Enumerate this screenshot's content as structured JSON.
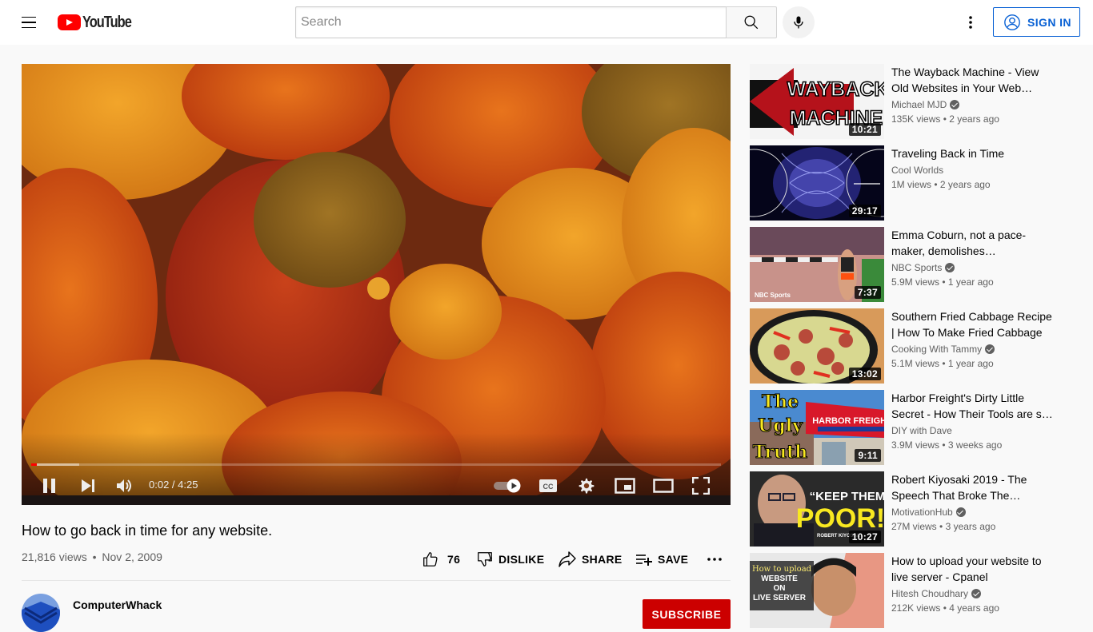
{
  "header": {
    "logo_text": "YouTube",
    "search_placeholder": "Search",
    "sign_in_label": "SIGN IN"
  },
  "colors": {
    "brand_red": "#ff0000",
    "subscribe_red": "#cc0000",
    "link_blue": "#065fd4",
    "muted_text": "#606060"
  },
  "player": {
    "time_display": "0:02 / 4:25",
    "current_time": "0:02",
    "duration": "4:25",
    "played_fraction": 0.008,
    "buffered_fraction": 0.07,
    "autoplay": true
  },
  "video": {
    "title": "How to go back in time for any website.",
    "views": "21,816 views",
    "date": "Nov 2, 2009",
    "meta_separator": "•",
    "likes": "76",
    "dislike_label": "DISLIKE",
    "share_label": "SHARE",
    "save_label": "SAVE",
    "channel_name": "ComputerWhack",
    "subscribe_label": "SUBSCRIBE"
  },
  "recommendations": [
    {
      "title": "The Wayback Machine - View Old Websites in Your Web…",
      "channel": "Michael MJD",
      "verified": true,
      "views": "135K views",
      "age": "2 years ago",
      "duration": "10:21",
      "thumb_text": [
        "WAYBACK",
        "MACHINE"
      ]
    },
    {
      "title": "Traveling Back in Time",
      "channel": "Cool Worlds",
      "verified": false,
      "views": "1M views",
      "age": "2 years ago",
      "duration": "29:17"
    },
    {
      "title": "Emma Coburn, not a pace-maker, demolishes…",
      "channel": "NBC Sports",
      "verified": true,
      "views": "5.9M views",
      "age": "1 year ago",
      "duration": "7:37",
      "thumb_text": [
        "NBC Sports"
      ]
    },
    {
      "title": "Southern Fried Cabbage Recipe | How To Make Fried Cabbage",
      "channel": "Cooking With Tammy",
      "verified": true,
      "views": "5.1M views",
      "age": "1 year ago",
      "duration": "13:02"
    },
    {
      "title": "Harbor Freight's Dirty Little Secret - How Their Tools are s…",
      "channel": "DIY with Dave",
      "verified": false,
      "views": "3.9M views",
      "age": "3 weeks ago",
      "duration": "9:11",
      "thumb_text": [
        "The",
        "Ugly",
        "Truth",
        "HARBOR FREIGHT"
      ]
    },
    {
      "title": "Robert Kiyosaki 2019 - The Speech That Broke The…",
      "channel": "MotivationHub",
      "verified": true,
      "views": "27M views",
      "age": "3 years ago",
      "duration": "10:27",
      "thumb_text": [
        "“KEEP THEM",
        "POOR!”",
        "ROBERT KIYOSAKI"
      ]
    },
    {
      "title": "How to upload your website to live server - Cpanel",
      "channel": "Hitesh Choudhary",
      "verified": true,
      "views": "212K views",
      "age": "4 years ago",
      "duration": "",
      "thumb_text": [
        "How to upload",
        "WEBSITE",
        "ON",
        "LIVE SERVER"
      ]
    }
  ]
}
